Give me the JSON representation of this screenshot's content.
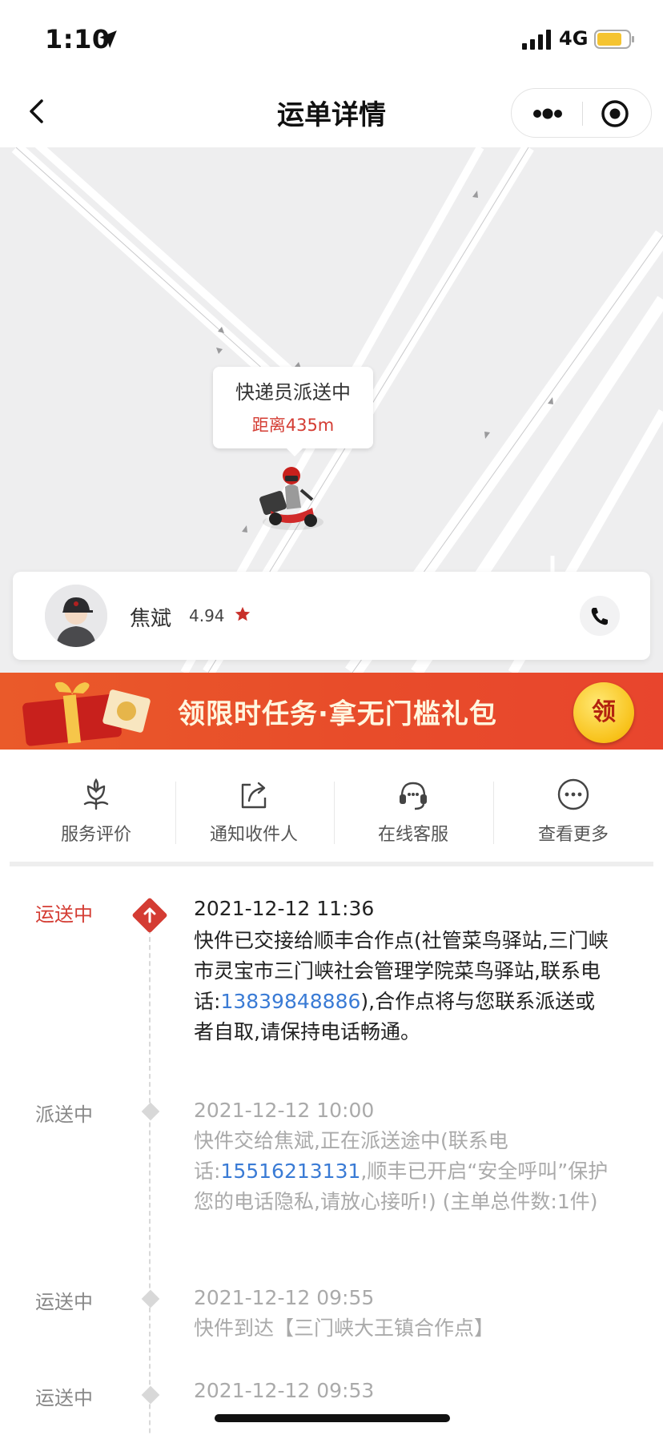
{
  "status_bar": {
    "time": "1:10",
    "network": "4G",
    "icons": [
      "location-arrow-icon",
      "signal-icon",
      "battery-icon"
    ]
  },
  "nav": {
    "title": "运单详情",
    "icons": [
      "back-arrow-icon",
      "more-dots-icon",
      "target-icon"
    ]
  },
  "map": {
    "bubble_title": "快递员派送中",
    "bubble_distance": "距离435m"
  },
  "courier": {
    "name": "焦斌",
    "rating": "4.94",
    "icons": [
      "avatar",
      "star-icon",
      "phone-icon"
    ]
  },
  "promo": {
    "text": "领限时任务·拿无门槛礼包",
    "button": "领"
  },
  "actions": [
    {
      "label": "服务评价",
      "icon": "flower-icon"
    },
    {
      "label": "通知收件人",
      "icon": "share-icon"
    },
    {
      "label": "在线客服",
      "icon": "headset-icon"
    },
    {
      "label": "查看更多",
      "icon": "more-circle-icon"
    }
  ],
  "timeline": [
    {
      "status": "运送中",
      "time": "2021-12-12 11:36",
      "desc_before": "快件已交接给顺丰合作点(社管菜鸟驿站,三门峡市灵宝市三门峡社会管理学院菜鸟驿站,联系电话:",
      "phone": "13839848886",
      "desc_after": "),合作点将与您联系派送或者自取,请保持电话畅通。"
    },
    {
      "status": "派送中",
      "time": "2021-12-12 10:00",
      "desc_before": "快件交给焦斌,正在派送途中(联系电话:",
      "phone": "15516213131",
      "desc_after": ",顺丰已开启“安全呼叫”保护您的电话隐私,请放心接听!) (主单总件数:1件)"
    },
    {
      "status": "运送中",
      "time": "2021-12-12 09:55",
      "desc_before": "快件到达【三门峡大王镇合作点】",
      "phone": "",
      "desc_after": ""
    },
    {
      "status": "运送中",
      "time": "2021-12-12 09:53",
      "desc_before": "",
      "phone": "",
      "desc_after": ""
    }
  ],
  "colors": {
    "accent_red": "#d43c33",
    "link_blue": "#3a7bd5",
    "promo_orange": "#e84d2a"
  }
}
